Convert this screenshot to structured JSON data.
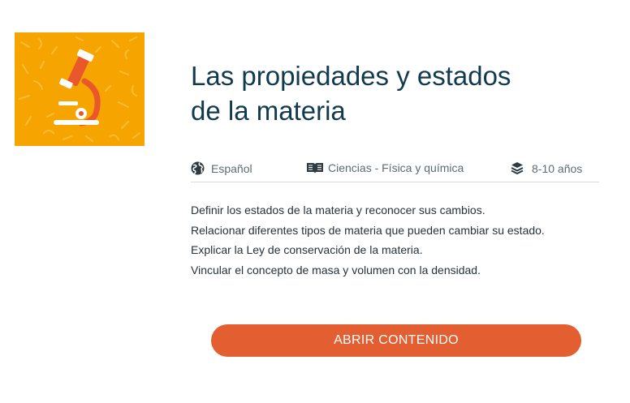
{
  "card": {
    "image_icon": "microscope-icon",
    "image_bg_color": "#f6a400",
    "title_line1": "Las propiedades y estados",
    "title_line2": "de la materia",
    "meta": {
      "language": {
        "icon": "globe-icon",
        "label": "Español"
      },
      "subject": {
        "icon": "book-icon",
        "label": "Ciencias - Física y química"
      },
      "age": {
        "icon": "layers-icon",
        "label": "8-10 años"
      }
    },
    "objectives": [
      "Definir los estados de la materia y reconocer sus cambios.",
      "Relacionar diferentes tipos de materia que pueden cambiar su estado.",
      "Explicar la Ley de conservación de la materia.",
      "Vincular el concepto de masa y volumen con la densidad."
    ],
    "open_button_label": "ABRIR CONTENIDO",
    "accent_color": "#e35e31",
    "title_color": "#123a4f"
  }
}
